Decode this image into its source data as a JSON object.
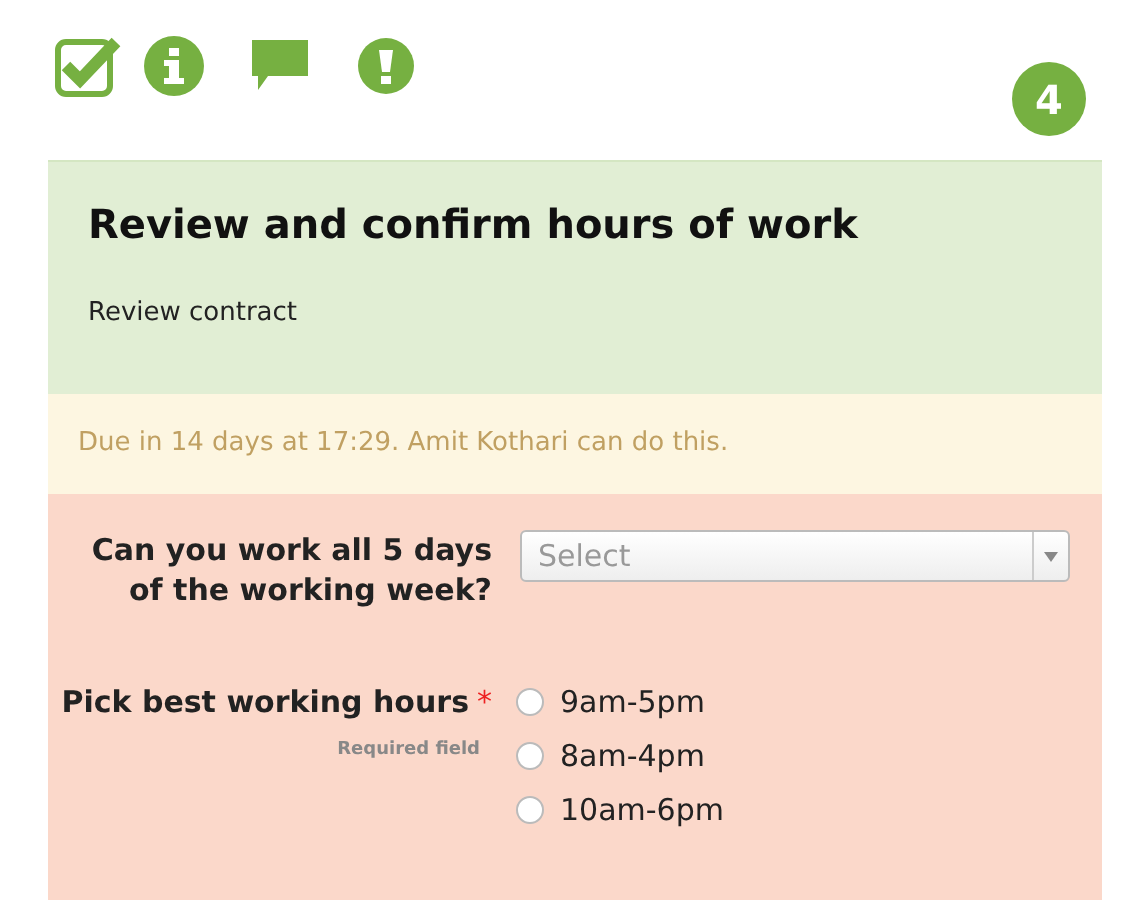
{
  "step_badge": "4",
  "card": {
    "title": "Review and confirm hours of work",
    "subtitle": "Review contract",
    "due_notice": "Due in 14 days at 17:29. Amit Kothari can do this.",
    "questions": [
      {
        "kind": "select",
        "label": "Can you work all 5 days of the working week?",
        "placeholder": "Select"
      },
      {
        "kind": "radio",
        "label": "Pick best working hours",
        "required_mark": "*",
        "hint": "Required field",
        "options": [
          {
            "label": "9am-5pm",
            "selected": false
          },
          {
            "label": "8am-4pm",
            "selected": false
          },
          {
            "label": "10am-6pm",
            "selected": false
          }
        ]
      }
    ]
  }
}
